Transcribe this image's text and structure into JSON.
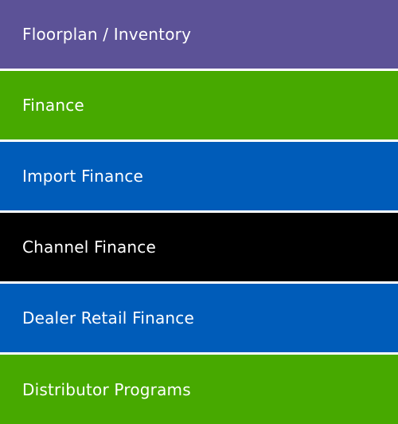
{
  "menu": {
    "items": [
      {
        "label": "Floorplan / Inventory",
        "color": "#5c5297"
      },
      {
        "label": "Finance",
        "color": "#47a900"
      },
      {
        "label": "Import Finance",
        "color": "#005cb9"
      },
      {
        "label": "Channel Finance",
        "color": "#000000"
      },
      {
        "label": "Dealer Retail Finance",
        "color": "#005cb9"
      },
      {
        "label": "Distributor Programs",
        "color": "#47a900"
      }
    ]
  }
}
